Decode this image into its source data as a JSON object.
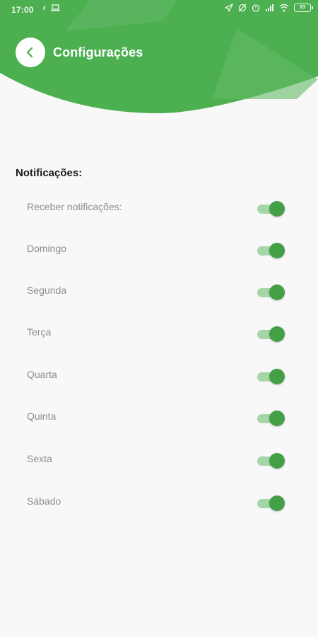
{
  "status_bar": {
    "time": "17:00",
    "battery": "83",
    "left_icons": [
      "navigation-arrow-icon",
      "laptop-icon"
    ],
    "right_icons": [
      "location-icon",
      "do-not-disturb-icon",
      "alarm-icon",
      "signal-icon",
      "wifi-icon",
      "battery-icon"
    ]
  },
  "header": {
    "title": "Configurações",
    "back_icon": "chevron-left-icon",
    "background_color": "#4caf50"
  },
  "notifications": {
    "title": "Notificações:",
    "items": [
      {
        "label": "Receber notificações:",
        "enabled": true
      },
      {
        "label": "Domingo",
        "enabled": true
      },
      {
        "label": "Segunda",
        "enabled": true
      },
      {
        "label": "Terça",
        "enabled": true
      },
      {
        "label": "Quarta",
        "enabled": true
      },
      {
        "label": "Quinta",
        "enabled": true
      },
      {
        "label": "Sexta",
        "enabled": true
      },
      {
        "label": "Sábado",
        "enabled": true
      }
    ]
  },
  "colors": {
    "primary": "#4caf50",
    "switch_on_thumb": "#43a047",
    "switch_on_track": "#a5d6a7",
    "background": "#f8f8f8"
  }
}
